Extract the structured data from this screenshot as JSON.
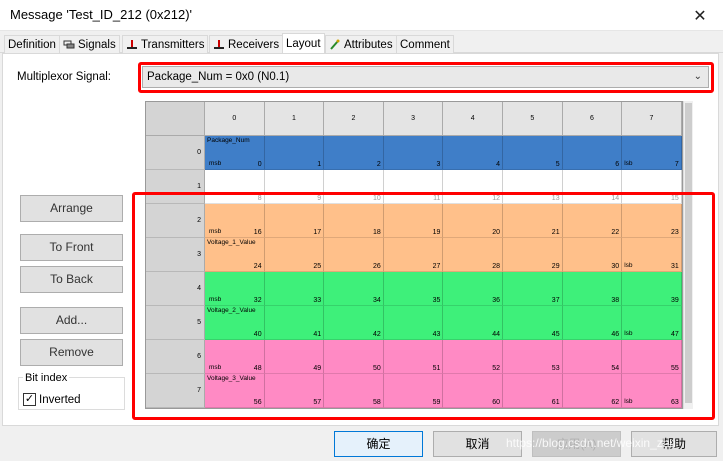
{
  "window": {
    "title": "Message 'Test_ID_212 (0x212)'",
    "close_glyph": "✕"
  },
  "tabs": [
    {
      "label": "Definition",
      "icon": ""
    },
    {
      "label": "Signals",
      "icon": "signals-icon"
    },
    {
      "label": "Transmitters",
      "icon": "transmitter-icon"
    },
    {
      "label": "Receivers",
      "icon": "receiver-icon"
    },
    {
      "label": "Layout",
      "icon": "",
      "active": true
    },
    {
      "label": "Attributes",
      "icon": "attributes-icon"
    },
    {
      "label": "Comment",
      "icon": ""
    }
  ],
  "multiplexor": {
    "label": "Multiplexor Signal:",
    "value": "Package_Num = 0x0 (N0.1)"
  },
  "side_buttons": {
    "arrange": "Arrange",
    "to_front": "To Front",
    "to_back": "To Back",
    "add": "Add...",
    "remove": "Remove"
  },
  "bit_index": {
    "legend": "Bit index",
    "inverted_label": "Inverted",
    "inverted_checked": true,
    "check_glyph": "✓"
  },
  "layout_grid": {
    "columns": [
      "0",
      "1",
      "2",
      "3",
      "4",
      "5",
      "6",
      "7"
    ],
    "rows": [
      "0",
      "1",
      "2",
      "3",
      "4",
      "5",
      "6",
      "7"
    ],
    "row_bits": [
      [
        "0",
        "1",
        "2",
        "3",
        "4",
        "5",
        "6",
        "7"
      ],
      [
        "8",
        "9",
        "10",
        "11",
        "12",
        "13",
        "14",
        "15"
      ],
      [
        "16",
        "17",
        "18",
        "19",
        "20",
        "21",
        "22",
        "23"
      ],
      [
        "24",
        "25",
        "26",
        "27",
        "28",
        "29",
        "30",
        "31"
      ],
      [
        "32",
        "33",
        "34",
        "35",
        "36",
        "37",
        "38",
        "39"
      ],
      [
        "40",
        "41",
        "42",
        "43",
        "44",
        "45",
        "46",
        "47"
      ],
      [
        "48",
        "49",
        "50",
        "51",
        "52",
        "53",
        "54",
        "55"
      ],
      [
        "56",
        "57",
        "58",
        "59",
        "60",
        "61",
        "62",
        "63"
      ]
    ],
    "signals": [
      {
        "name": "Package_Num",
        "rows": [
          0
        ],
        "color": "#3f7ec8",
        "msb": "msb",
        "lsb": "lsb"
      },
      {
        "name": "Voltage_1_Value",
        "rows": [
          2,
          3
        ],
        "color": "#ffc08a",
        "msb": "msb",
        "lsb": "lsb"
      },
      {
        "name": "Voltage_2_Value",
        "rows": [
          4,
          5
        ],
        "color": "#3ef07a",
        "msb": "msb",
        "lsb": "lsb"
      },
      {
        "name": "Voltage_3_Value",
        "rows": [
          6,
          7
        ],
        "color": "#ff8ac4",
        "msb": "msb",
        "lsb": "lsb"
      }
    ]
  },
  "buttons": {
    "ok": "确定",
    "cancel": "取消",
    "apply": "应用(A)",
    "help": "帮助"
  },
  "watermark": "https://blog.csdn.net/weixin_zhu",
  "colors": {
    "highlight": "#ff0000",
    "row_empty": "#ffffff"
  }
}
